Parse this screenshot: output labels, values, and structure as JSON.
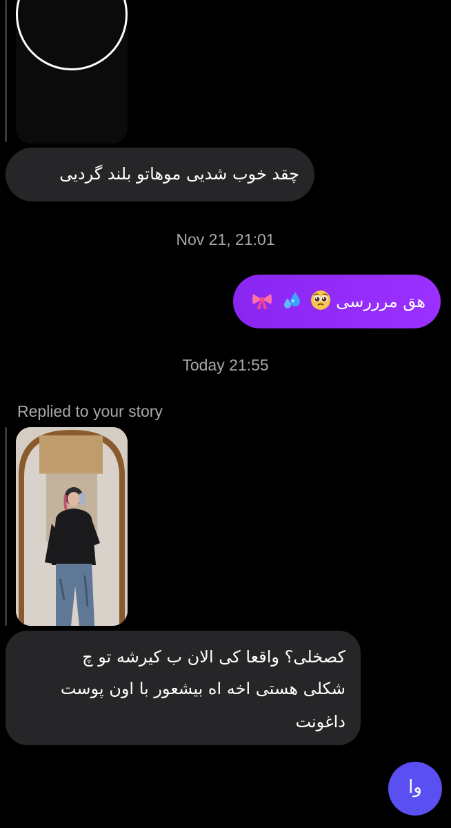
{
  "colors": {
    "background": "#000000",
    "incoming_bubble": "#262628",
    "outgoing_gradient_start": "#7b22ef",
    "outgoing_gradient_end": "#9b30ff",
    "outgoing_round": "#5a4ff0",
    "meta_text": "#a8a8ad"
  },
  "messages": [
    {
      "type": "story_reply_preview",
      "direction": "incoming",
      "icon": "story-thumbnail-ring"
    },
    {
      "type": "text",
      "direction": "incoming",
      "text": "چقد خوب شدیی موهاتو بلند گردیی"
    },
    {
      "type": "timestamp",
      "text": "Nov 21, 21:01"
    },
    {
      "type": "text",
      "direction": "outgoing",
      "text": "هق مرررسی",
      "emojis": [
        "pleading-face-emoji",
        "sweat-droplets-emoji",
        "ribbon-emoji"
      ]
    },
    {
      "type": "timestamp",
      "text": "Today 21:55"
    },
    {
      "type": "label",
      "text": "Replied to your story"
    },
    {
      "type": "story_reply_preview",
      "direction": "incoming",
      "icon": "story-photo-mirror-selfie"
    },
    {
      "type": "text",
      "direction": "incoming",
      "text": "کصخلی؟ واقعا کی الان ب کیرشه تو چ شکلی هستی اخه اه بیشعور با اون پوست داغونت"
    },
    {
      "type": "text",
      "direction": "outgoing",
      "text": "وا"
    }
  ],
  "chat": {
    "msg1": "چقد خوب شدیی موهاتو بلند گردیی",
    "ts1": "Nov 21, 21:01",
    "msg2": "هق مرررسی",
    "ts2": "Today 21:55",
    "replied": "Replied to your story",
    "msg3_line1": "کصخلی؟ واقعا کی الان ب کیرشه تو چ",
    "msg3_line2": "شکلی هستی اخه اه بیشعور با اون پوست",
    "msg3_line3": "داغونت",
    "msg4": "وا"
  }
}
